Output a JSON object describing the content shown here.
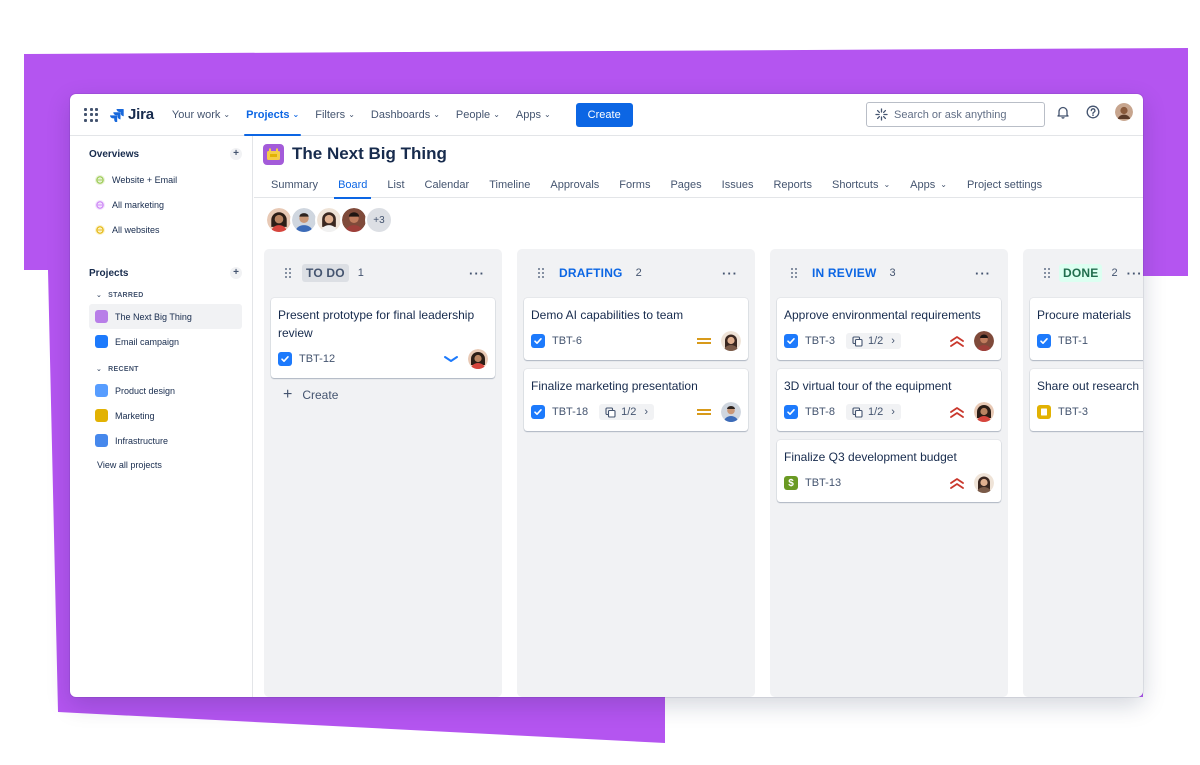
{
  "topnav": {
    "logo": "Jira",
    "items": [
      {
        "label": "Your work",
        "active": false
      },
      {
        "label": "Projects",
        "active": true
      },
      {
        "label": "Filters",
        "active": false
      },
      {
        "label": "Dashboards",
        "active": false
      },
      {
        "label": "People",
        "active": false
      },
      {
        "label": "Apps",
        "active": false
      }
    ],
    "create_label": "Create",
    "search_placeholder": "Search or ask anything"
  },
  "sidebar": {
    "overviews_title": "Overviews",
    "overviews": [
      {
        "label": "Website + Email",
        "color": "#94c748"
      },
      {
        "label": "All marketing",
        "color": "#c97cf4"
      },
      {
        "label": "All websites",
        "color": "#f5cd47"
      }
    ],
    "projects_title": "Projects",
    "starred_label": "STARRED",
    "starred": [
      {
        "label": "The Next Big Thing",
        "selected": true
      },
      {
        "label": "Email campaign",
        "selected": false
      }
    ],
    "recent_label": "RECENT",
    "recent": [
      {
        "label": "Product design"
      },
      {
        "label": "Marketing"
      },
      {
        "label": "Infrastructure"
      }
    ],
    "view_all": "View all projects"
  },
  "project": {
    "title": "The Next Big Thing",
    "tabs": [
      {
        "label": "Summary",
        "active": false
      },
      {
        "label": "Board",
        "active": true
      },
      {
        "label": "List",
        "active": false
      },
      {
        "label": "Calendar",
        "active": false
      },
      {
        "label": "Timeline",
        "active": false
      },
      {
        "label": "Approvals",
        "active": false
      },
      {
        "label": "Forms",
        "active": false
      },
      {
        "label": "Pages",
        "active": false
      },
      {
        "label": "Issues",
        "active": false
      },
      {
        "label": "Reports",
        "active": false
      },
      {
        "label": "Shortcuts",
        "active": false
      },
      {
        "label": "Apps",
        "active": false
      },
      {
        "label": "Project settings",
        "active": false
      }
    ],
    "more_people": "+3"
  },
  "board": {
    "create_label": "Create",
    "columns": [
      {
        "name": "TO DO",
        "count": "1",
        "name_bg": "#dcdfe4",
        "name_color": "#44546f",
        "cards": [
          {
            "title": "Present prototype for final leadership review",
            "key": "TBT-12",
            "type": "task",
            "priority": "low",
            "subtasks": ""
          }
        ]
      },
      {
        "name": "DRAFTING",
        "count": "2",
        "name_bg": "transparent",
        "name_color": "#0c66e4",
        "cards": [
          {
            "title": "Demo AI capabilities to team",
            "key": "TBT-6",
            "type": "task",
            "priority": "medium",
            "subtasks": ""
          },
          {
            "title": "Finalize marketing presentation",
            "key": "TBT-18",
            "type": "task",
            "priority": "medium",
            "subtasks": "1/2"
          }
        ]
      },
      {
        "name": "IN REVIEW",
        "count": "3",
        "name_bg": "transparent",
        "name_color": "#0c66e4",
        "cards": [
          {
            "title": "Approve environmental requirements",
            "key": "TBT-3",
            "type": "task",
            "priority": "high",
            "subtasks": "1/2"
          },
          {
            "title": "3D virtual tour of the equipment",
            "key": "TBT-8",
            "type": "task",
            "priority": "high",
            "subtasks": "1/2"
          },
          {
            "title": "Finalize Q3 development budget",
            "key": "TBT-13",
            "type": "money",
            "priority": "high",
            "subtasks": ""
          }
        ]
      },
      {
        "name": "DONE",
        "count": "2",
        "name_bg": "#dcfff1",
        "name_color": "#216e4e",
        "cards": [
          {
            "title": "Procure materials",
            "key": "TBT-1",
            "type": "task",
            "priority": "",
            "subtasks": ""
          },
          {
            "title": "Share out research test results",
            "key": "TBT-3",
            "type": "story",
            "priority": "",
            "subtasks": ""
          }
        ]
      }
    ]
  }
}
